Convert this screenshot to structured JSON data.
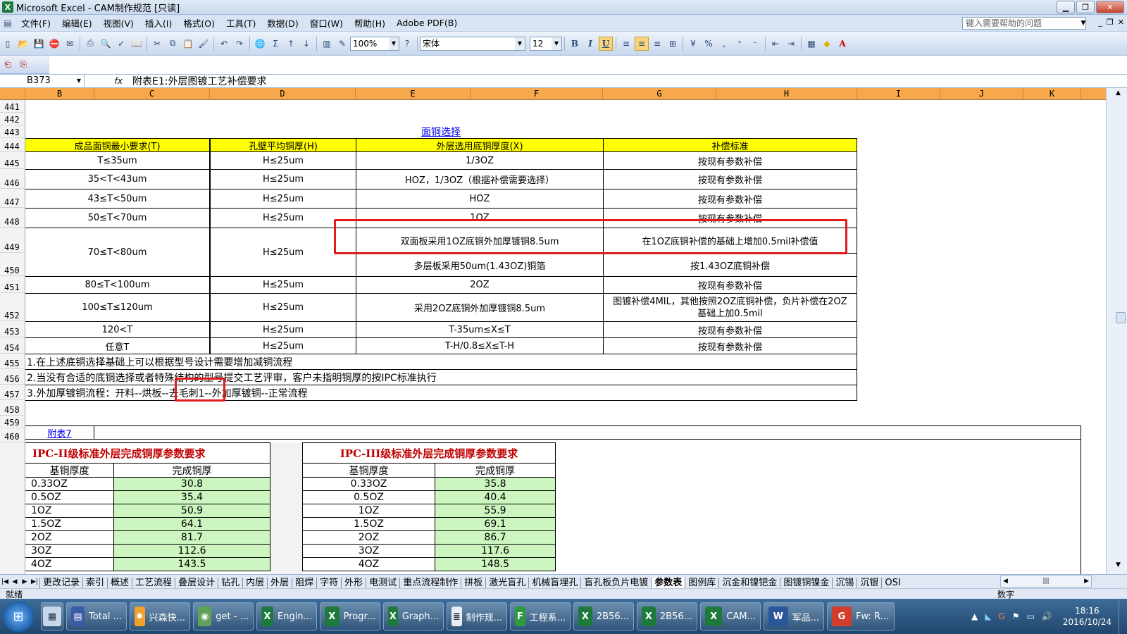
{
  "window": {
    "title": "Microsoft Excel - CAM制作规范  [只读]"
  },
  "menubar": {
    "items": [
      "文件(F)",
      "编辑(E)",
      "视图(V)",
      "插入(I)",
      "格式(O)",
      "工具(T)",
      "数据(D)",
      "窗口(W)",
      "帮助(H)",
      "Adobe PDF(B)"
    ],
    "help_placeholder": "键入需要帮助的问题"
  },
  "toolbar": {
    "zoom": "100%",
    "font": "宋体",
    "font_size": "12"
  },
  "formula_bar": {
    "cell_ref": "B373",
    "fx": "fx",
    "content": "附表E1:外层图镀工艺补偿要求"
  },
  "columns": [
    "B",
    "C",
    "D",
    "E",
    "F",
    "G",
    "H",
    "I",
    "J",
    "K"
  ],
  "rows": [
    "441",
    "442",
    "443",
    "444",
    "445",
    "446",
    "447",
    "448",
    "449",
    "450",
    "451",
    "452",
    "453",
    "454",
    "455",
    "456",
    "457",
    "458",
    "459",
    "460"
  ],
  "table1": {
    "title": "面铜选择",
    "headers": [
      "成品面铜最小要求(T)",
      "孔壁平均铜厚(H)",
      "外层选用底铜厚度(X)",
      "补偿标准"
    ],
    "rows": [
      {
        "t": "T≤35um",
        "h": "H≤25um",
        "x": "1/3OZ",
        "s": "按现有参数补偿"
      },
      {
        "t": "35<T<43um",
        "h": "H≤25um",
        "x": "HOZ，1/3OZ（根据补偿需要选择）",
        "s": "按现有参数补偿"
      },
      {
        "t": "43≤T<50um",
        "h": "H≤25um",
        "x": "HOZ",
        "s": "按现有参数补偿"
      },
      {
        "t": "50≤T<70um",
        "h": "H≤25um",
        "x": "1OZ",
        "s": "按现有参数补偿"
      },
      {
        "t": "70≤T<80um",
        "h": "H≤25um",
        "x": "双面板采用1OZ底铜外加厚镀铜8.5um",
        "s": "在1OZ底铜补偿的基础上增加0.5mil补偿值",
        "x2": "多层板采用50um(1.43OZ)铜箔",
        "s2": "按1.43OZ底铜补偿"
      },
      {
        "t": "80≤T<100um",
        "h": "H≤25um",
        "x": "2OZ",
        "s": "按现有参数补偿"
      },
      {
        "t": "100≤T≤120um",
        "h": "H≤25um",
        "x": "采用2OZ底铜外加厚镀铜8.5um",
        "s": "图镀补偿4MIL，其他按照2OZ底铜补偿，负片补偿在2OZ基础上加0.5mil"
      },
      {
        "t": "120<T",
        "h": "H≤25um",
        "x": "T-35um≤X≤T",
        "s": "按现有参数补偿"
      },
      {
        "t": "任意T",
        "h": "H≤25um",
        "x": "T-H/0.8≤X≤T-H",
        "s": "按现有参数补偿"
      }
    ],
    "notes": [
      "1.在上述底铜选择基础上可以根据型号设计需要增加减铜流程",
      "2.当没有合适的底铜选择或者特殊结构的型号提交工艺评审，客户未指明铜厚的按IPC标准执行",
      "3.外加厚镀铜流程：开料--烘板--去毛刺1--外加厚镀铜--正常流程"
    ]
  },
  "appendix7": {
    "label": "附表7"
  },
  "ipc2": {
    "title": "IPC-II级标准外层完成铜厚参数要求",
    "col1": "基铜厚度",
    "col2": "完成铜厚",
    "rows": [
      [
        "0.33OZ",
        "30.8"
      ],
      [
        "0.5OZ",
        "35.4"
      ],
      [
        "1OZ",
        "50.9"
      ],
      [
        "1.5OZ",
        "64.1"
      ],
      [
        "2OZ",
        "81.7"
      ],
      [
        "3OZ",
        "112.6"
      ],
      [
        "4OZ",
        "143.5"
      ]
    ]
  },
  "ipc3": {
    "title": "IPC-III级标准外层完成铜厚参数要求",
    "col1": "基铜厚度",
    "col2": "完成铜厚",
    "rows": [
      [
        "0.33OZ",
        "35.8"
      ],
      [
        "0.5OZ",
        "40.4"
      ],
      [
        "1OZ",
        "55.9"
      ],
      [
        "1.5OZ",
        "69.1"
      ],
      [
        "2OZ",
        "86.7"
      ],
      [
        "3OZ",
        "117.6"
      ],
      [
        "4OZ",
        "148.5"
      ]
    ]
  },
  "sheet_tabs": [
    "更改记录",
    "索引",
    "概述",
    "工艺流程",
    "叠层设计",
    "钻孔",
    "内层",
    "外层",
    "阻焊",
    "字符",
    "外形",
    "电测试",
    "重点流程制作",
    "拼板",
    "激光盲孔",
    "机械盲埋孔",
    "盲孔板负片电镀",
    "参数表",
    "图例库",
    "沉金和镍钯金",
    "图镀铜镍金",
    "沉锡",
    "沉银",
    "OSI"
  ],
  "active_tab": "参数表",
  "status": {
    "left": "就绪",
    "right": "数字"
  },
  "taskbar": {
    "items": [
      "Total ...",
      "兴森快...",
      "get - ...",
      "Engin...",
      "Progr...",
      "Graph...",
      "制作规...",
      "工程系...",
      "2B56...",
      "2B56...",
      "CAM...",
      "军品...",
      "Fw: R..."
    ],
    "time": "18:16",
    "date": "2016/10/24"
  }
}
